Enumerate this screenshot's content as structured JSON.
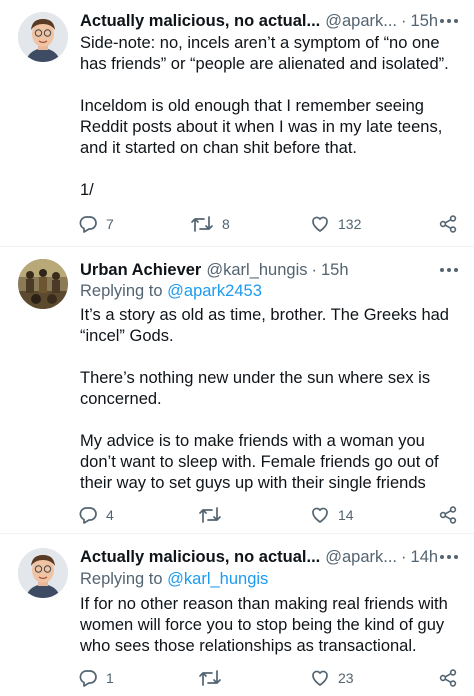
{
  "tweets": [
    {
      "name": "Actually malicious, no actual...",
      "handle": "@apark...",
      "time": "15h",
      "replying_label": "",
      "replying_to": "",
      "paragraphs": [
        "Side-note: no, incels aren’t a symptom of “no one has friends” or “people are alienated and isolated”.",
        "Inceldom is old enough that I remember seeing Reddit posts about it when I was in my late teens, and it started on chan shit before that.",
        "1/"
      ],
      "replies": "7",
      "retweets": "8",
      "likes": "132"
    },
    {
      "name": "Urban Achiever",
      "handle": "@karl_hungis",
      "time": "15h",
      "replying_label": "Replying to",
      "replying_to": "@apark2453",
      "paragraphs": [
        "It’s a story as old as time, brother. The Greeks had “incel” Gods.",
        "There’s nothing new under the sun where sex is concerned.",
        "My advice is to make friends with a woman you don’t want to sleep with. Female friends go out of their way to set guys up with their single friends"
      ],
      "replies": "4",
      "retweets": "",
      "likes": "14"
    },
    {
      "name": "Actually malicious, no actual...",
      "handle": "@apark...",
      "time": "14h",
      "replying_label": "Replying to",
      "replying_to": "@karl_hungis",
      "paragraphs": [
        "If for no other reason than making real friends with women will force you to stop being the kind of guy who sees those relationships as transactional."
      ],
      "replies": "1",
      "retweets": "",
      "likes": "23"
    }
  ],
  "separator": "·",
  "icons": {
    "reply": "reply-icon",
    "retweet": "retweet-icon",
    "like": "like-icon",
    "share": "share-icon",
    "more": "more-icon"
  },
  "colors": {
    "text": "#0f1419",
    "secondary": "#536471",
    "link": "#1d9bf0",
    "divider": "#eff3f4"
  }
}
